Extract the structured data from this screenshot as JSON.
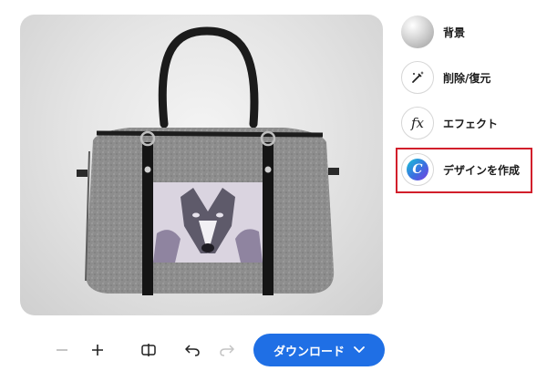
{
  "side_panel": {
    "tools": [
      {
        "label": "背景",
        "icon": "background-sphere-icon"
      },
      {
        "label": "削除/復元",
        "icon": "magic-brush-icon"
      },
      {
        "label": "エフェクト",
        "icon": "fx-icon"
      },
      {
        "label": "デザインを作成",
        "icon": "canva-logo-icon"
      }
    ],
    "highlight_color": "#d21f2b"
  },
  "fx_glyph": "fx",
  "canva_glyph": "C",
  "toolbar": {
    "zoom_out_icon": "minus-icon",
    "zoom_in_icon": "plus-icon",
    "compare_icon": "compare-icon",
    "undo_icon": "undo-icon",
    "redo_icon": "redo-icon",
    "download_label": "ダウンロード",
    "accent": "#1f6fe5"
  },
  "preview": {
    "subject": "gray felt duffel handbag with husky embroidery"
  }
}
